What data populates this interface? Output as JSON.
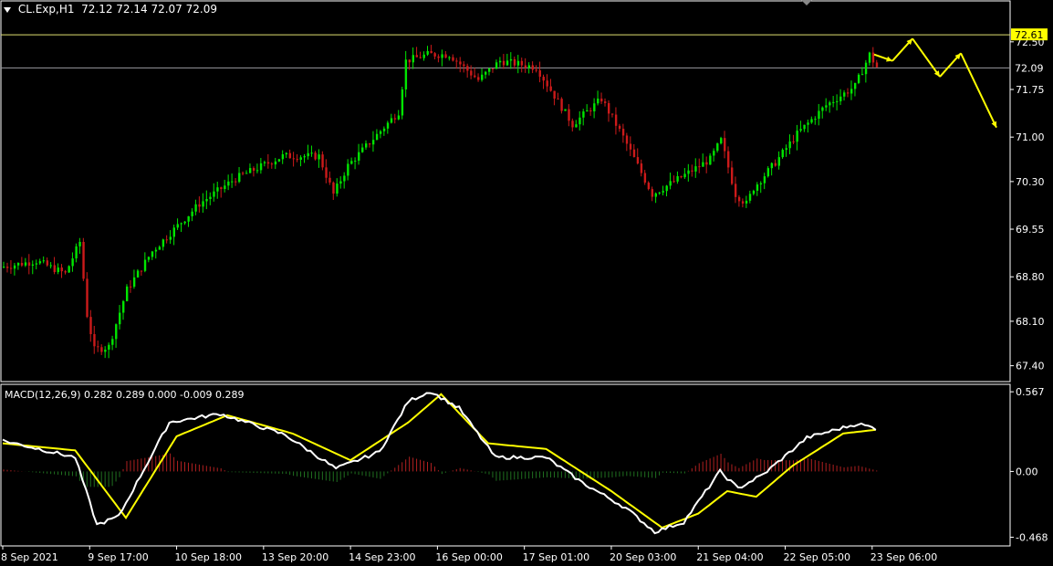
{
  "header": {
    "symbol": "CL.Exp,H1",
    "ohlc": "72.12 72.14 72.07 72.09"
  },
  "macd_header": "MACD(12,26,9) 0.282 0.289 0.000 -0.009 0.289",
  "colors": {
    "background": "#000000",
    "bull": "#00e600",
    "bear": "#cc1a1a",
    "grid_frame": "#ffffff",
    "macd_main": "#ffffff",
    "macd_signal": "#ffff00",
    "hist_pos": "#b02020",
    "hist_neg": "#207020",
    "forecast": "#ffff00",
    "level_label_bg": "#ffff00"
  },
  "chart_data": [
    {
      "type": "candlestick",
      "symbol": "CL.Exp",
      "timeframe": "H1",
      "ylim": [
        67.15,
        72.9
      ],
      "y_ticks": [
        "72.50",
        "71.75",
        "71.00",
        "70.30",
        "69.55",
        "68.80",
        "68.10",
        "67.40"
      ],
      "y_tick_values": [
        72.5,
        71.75,
        71.0,
        70.3,
        69.55,
        68.8,
        68.1,
        67.4
      ],
      "x_ticks": [
        "8 Sep 2021",
        "9 Sep 17:00",
        "10 Sep 18:00",
        "13 Sep 20:00",
        "14 Sep 23:00",
        "16 Sep 00:00",
        "17 Sep 01:00",
        "20 Sep 03:00",
        "21 Sep 04:00",
        "22 Sep 05:00",
        "23 Sep 06:00"
      ],
      "levels": [
        {
          "label": "72.61",
          "value": 72.61,
          "highlight": true
        },
        {
          "label": "72.09",
          "value": 72.09,
          "highlight": false
        }
      ],
      "path_anchors": [
        [
          0,
          68.95
        ],
        [
          10,
          69.05
        ],
        [
          18,
          68.85
        ],
        [
          22,
          69.35
        ],
        [
          24,
          68.2
        ],
        [
          26,
          67.65
        ],
        [
          30,
          67.7
        ],
        [
          35,
          68.6
        ],
        [
          42,
          69.2
        ],
        [
          55,
          69.95
        ],
        [
          65,
          70.35
        ],
        [
          78,
          70.7
        ],
        [
          88,
          70.7
        ],
        [
          92,
          70.1
        ],
        [
          96,
          70.55
        ],
        [
          110,
          71.4
        ],
        [
          112,
          72.2
        ],
        [
          118,
          72.3
        ],
        [
          124,
          72.3
        ],
        [
          132,
          71.9
        ],
        [
          138,
          72.2
        ],
        [
          148,
          72.1
        ],
        [
          158,
          71.2
        ],
        [
          166,
          71.6
        ],
        [
          172,
          71.0
        ],
        [
          180,
          70.1
        ],
        [
          186,
          70.3
        ],
        [
          196,
          70.65
        ],
        [
          199,
          70.95
        ],
        [
          203,
          70.1
        ],
        [
          206,
          69.95
        ],
        [
          208,
          70.2
        ],
        [
          214,
          70.6
        ],
        [
          220,
          71.05
        ],
        [
          228,
          71.5
        ],
        [
          236,
          71.8
        ],
        [
          240,
          72.3
        ],
        [
          242,
          72.1
        ]
      ],
      "forecast": [
        72.2,
        72.55,
        71.95,
        72.32,
        71.15
      ]
    },
    {
      "type": "line",
      "title": "MACD(12,26,9)",
      "values_shown": [
        "0.282",
        "0.289",
        "0.000",
        "-0.009",
        "0.289"
      ],
      "ylim": [
        -0.53,
        0.62
      ],
      "y_ticks": [
        "0.567",
        "0.00",
        "-0.468"
      ],
      "y_tick_values": [
        0.567,
        0.0,
        -0.468
      ],
      "series": [
        {
          "role": "main",
          "anchors": [
            [
              0,
              0.22
            ],
            [
              20,
              0.1
            ],
            [
              26,
              -0.38
            ],
            [
              32,
              -0.32
            ],
            [
              46,
              0.35
            ],
            [
              60,
              0.41
            ],
            [
              78,
              0.26
            ],
            [
              92,
              0.02
            ],
            [
              104,
              0.14
            ],
            [
              112,
              0.5
            ],
            [
              118,
              0.57
            ],
            [
              126,
              0.45
            ],
            [
              136,
              0.1
            ],
            [
              150,
              0.1
            ],
            [
              160,
              -0.08
            ],
            [
              172,
              -0.26
            ],
            [
              180,
              -0.43
            ],
            [
              188,
              -0.36
            ],
            [
              198,
              -0.0
            ],
            [
              203,
              -0.12
            ],
            [
              210,
              -0.02
            ],
            [
              222,
              0.24
            ],
            [
              236,
              0.34
            ],
            [
              242,
              0.3
            ]
          ]
        },
        {
          "role": "signal",
          "anchors": [
            [
              0,
              0.2
            ],
            [
              20,
              0.15
            ],
            [
              34,
              -0.33
            ],
            [
              48,
              0.25
            ],
            [
              62,
              0.4
            ],
            [
              80,
              0.27
            ],
            [
              96,
              0.08
            ],
            [
              112,
              0.35
            ],
            [
              121,
              0.55
            ],
            [
              134,
              0.2
            ],
            [
              150,
              0.16
            ],
            [
              168,
              -0.14
            ],
            [
              182,
              -0.4
            ],
            [
              192,
              -0.3
            ],
            [
              200,
              -0.14
            ],
            [
              208,
              -0.18
            ],
            [
              218,
              0.04
            ],
            [
              232,
              0.27
            ],
            [
              242,
              0.3
            ]
          ]
        }
      ]
    }
  ]
}
